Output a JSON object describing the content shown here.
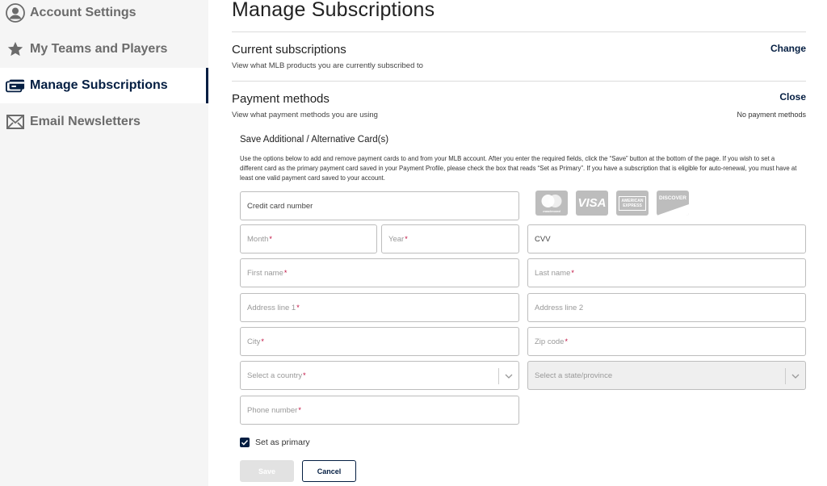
{
  "sidebar": {
    "items": [
      {
        "label": "Account Settings",
        "icon": "account-icon"
      },
      {
        "label": "My Teams and Players",
        "icon": "star-icon"
      },
      {
        "label": "Manage Subscriptions",
        "icon": "subscriptions-icon",
        "active": true
      },
      {
        "label": "Email Newsletters",
        "icon": "envelope-icon"
      }
    ]
  },
  "main": {
    "title": "Manage Subscriptions",
    "current": {
      "title": "Current subscriptions",
      "desc": "View what MLB products you are currently subscribed to",
      "link": "Change"
    },
    "payment": {
      "title": "Payment methods",
      "desc": "View what payment methods you are using",
      "link": "Close",
      "status": "No payment methods"
    }
  },
  "form": {
    "title": "Save Additional / Alternative Card(s)",
    "desc": "Use the options below to add and remove payment cards to and from your MLB account. After you enter the required fields, click the “Save” button at the bottom of the page. If you wish to set a different card as the primary payment card saved in your Payment Profile, please check the box that reads “Set as Primary”. If you have a subscription that is eligible for auto-renewal, you must have at least one valid payment card saved to your account.",
    "card_number": "Credit card number",
    "month": "Month",
    "year": "Year",
    "cvv": "CVV",
    "first_name": "First name",
    "last_name": "Last name",
    "address1": "Address line 1",
    "address2": "Address line 2",
    "city": "City",
    "zip": "Zip code",
    "country": "Select a country",
    "state": "Select a state/province",
    "phone": "Phone number",
    "required_mark": "*",
    "set_primary": "Set as primary",
    "set_primary_checked": true,
    "save": "Save",
    "cancel": "Cancel",
    "card_logos": [
      {
        "name": "mastercard",
        "text": "mastercard"
      },
      {
        "name": "visa",
        "text": "VISA"
      },
      {
        "name": "american-express",
        "text": "AMERICAN EXPRESS"
      },
      {
        "name": "discover",
        "text": "DISCOVER"
      }
    ]
  },
  "colors": {
    "brand_navy": "#041e42",
    "required_red": "#bf0d3e",
    "sidebar_bg": "#f5f5f5",
    "muted_text": "#6b6b6b"
  }
}
